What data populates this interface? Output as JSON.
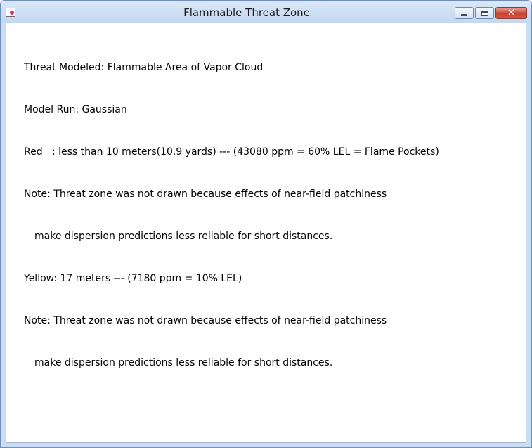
{
  "window": {
    "title": "Flammable Threat Zone",
    "controls": {
      "minimize_icon": "minimize-icon",
      "maximize_icon": "maximize-icon",
      "close_label": "✕"
    }
  },
  "report": {
    "lines": [
      {
        "text": "Threat Modeled: Flammable Area of Vapor Cloud",
        "indent": false
      },
      {
        "text": "Model Run: Gaussian",
        "indent": false
      },
      {
        "text": "Red   : less than 10 meters(10.9 yards) --- (43080 ppm = 60% LEL = Flame Pockets)",
        "indent": false
      },
      {
        "text": "Note: Threat zone was not drawn because effects of near-field patchiness",
        "indent": false
      },
      {
        "text": "make dispersion predictions less reliable for short distances.",
        "indent": true
      },
      {
        "text": "Yellow: 17 meters --- (7180 ppm = 10% LEL)",
        "indent": false
      },
      {
        "text": "Note: Threat zone was not drawn because effects of near-field patchiness",
        "indent": false
      },
      {
        "text": "make dispersion predictions less reliable for short distances.",
        "indent": true
      }
    ]
  },
  "colors": {
    "title_bar": "#c9dcf3",
    "close_button": "#c7432f",
    "app_icon_dot": "#e0237a"
  }
}
